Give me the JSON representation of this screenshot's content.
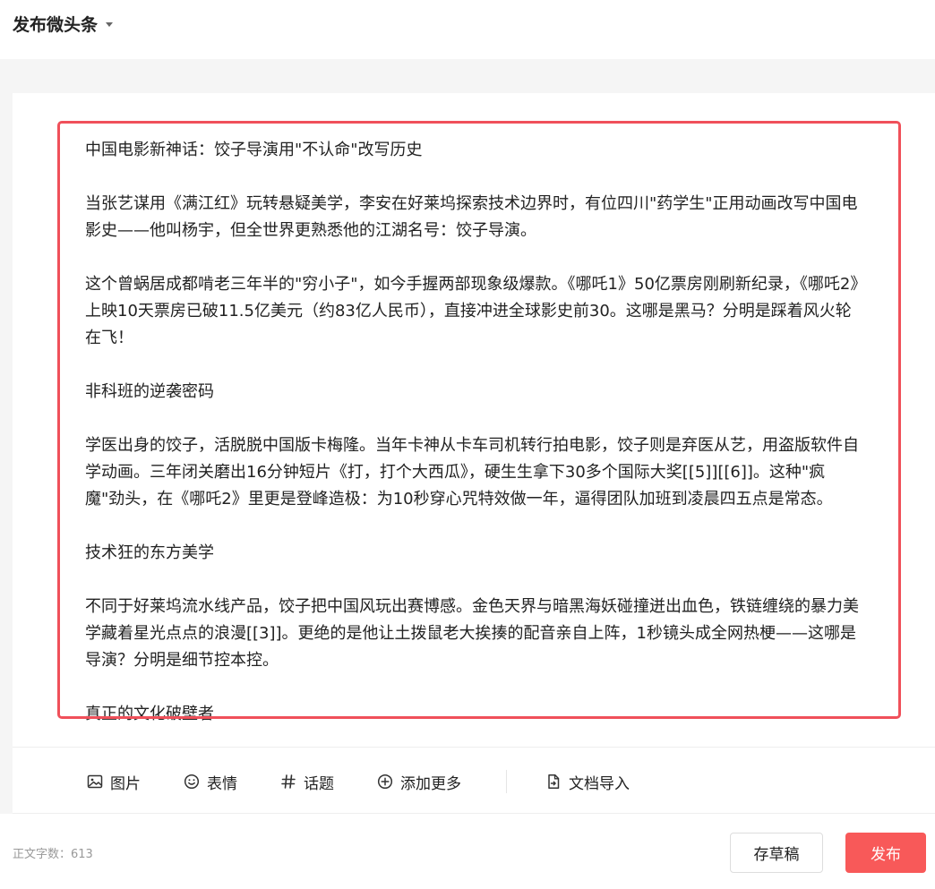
{
  "header": {
    "title": "发布微头条"
  },
  "editor": {
    "paragraphs": [
      "中国电影新神话：饺子导演用\"不认命\"改写历史",
      "当张艺谋用《满江红》玩转悬疑美学，李安在好莱坞探索技术边界时，有位四川\"药学生\"正用动画改写中国电影史——他叫杨宇，但全世界更熟悉他的江湖名号：饺子导演。",
      "这个曾蜗居成都啃老三年半的\"穷小子\"，如今手握两部现象级爆款。《哪吒1》50亿票房刚刷新纪录，《哪吒2》上映10天票房已破11.5亿美元（约83亿人民币），直接冲进全球影史前30。这哪是黑马？分明是踩着风火轮在飞！",
      "非科班的逆袭密码",
      "学医出身的饺子，活脱脱中国版卡梅隆。当年卡神从卡车司机转行拍电影，饺子则是弃医从艺，用盗版软件自学动画。三年闭关磨出16分钟短片《打，打个大西瓜》，硬生生拿下30多个国际大奖[[5]][[6]]。这种\"疯魔\"劲头，在《哪吒2》里更是登峰造极：为10秒穿心咒特效做一年，逼得团队加班到凌晨四五点是常态。",
      "技术狂的东方美学",
      "不同于好莱坞流水线产品，饺子把中国风玩出赛博感。金色天界与暗黑海妖碰撞迸出血色，铁链缠绕的暴力美学藏着星光点点的浪漫[[3]]。更绝的是他让土拨鼠老大挨揍的配音亲自上阵，1秒镜头成全网热梗——这哪是导演？分明是细节控本控。",
      "真正的文化破壁者"
    ]
  },
  "toolbar": {
    "image_label": "图片",
    "emoji_label": "表情",
    "topic_label": "话题",
    "more_label": "添加更多",
    "import_label": "文档导入"
  },
  "footer": {
    "word_count": "正文字数：613",
    "draft_label": "存草稿",
    "publish_label": "发布"
  },
  "colors": {
    "accent": "#f85959",
    "highlight_border": "#f0505a"
  }
}
